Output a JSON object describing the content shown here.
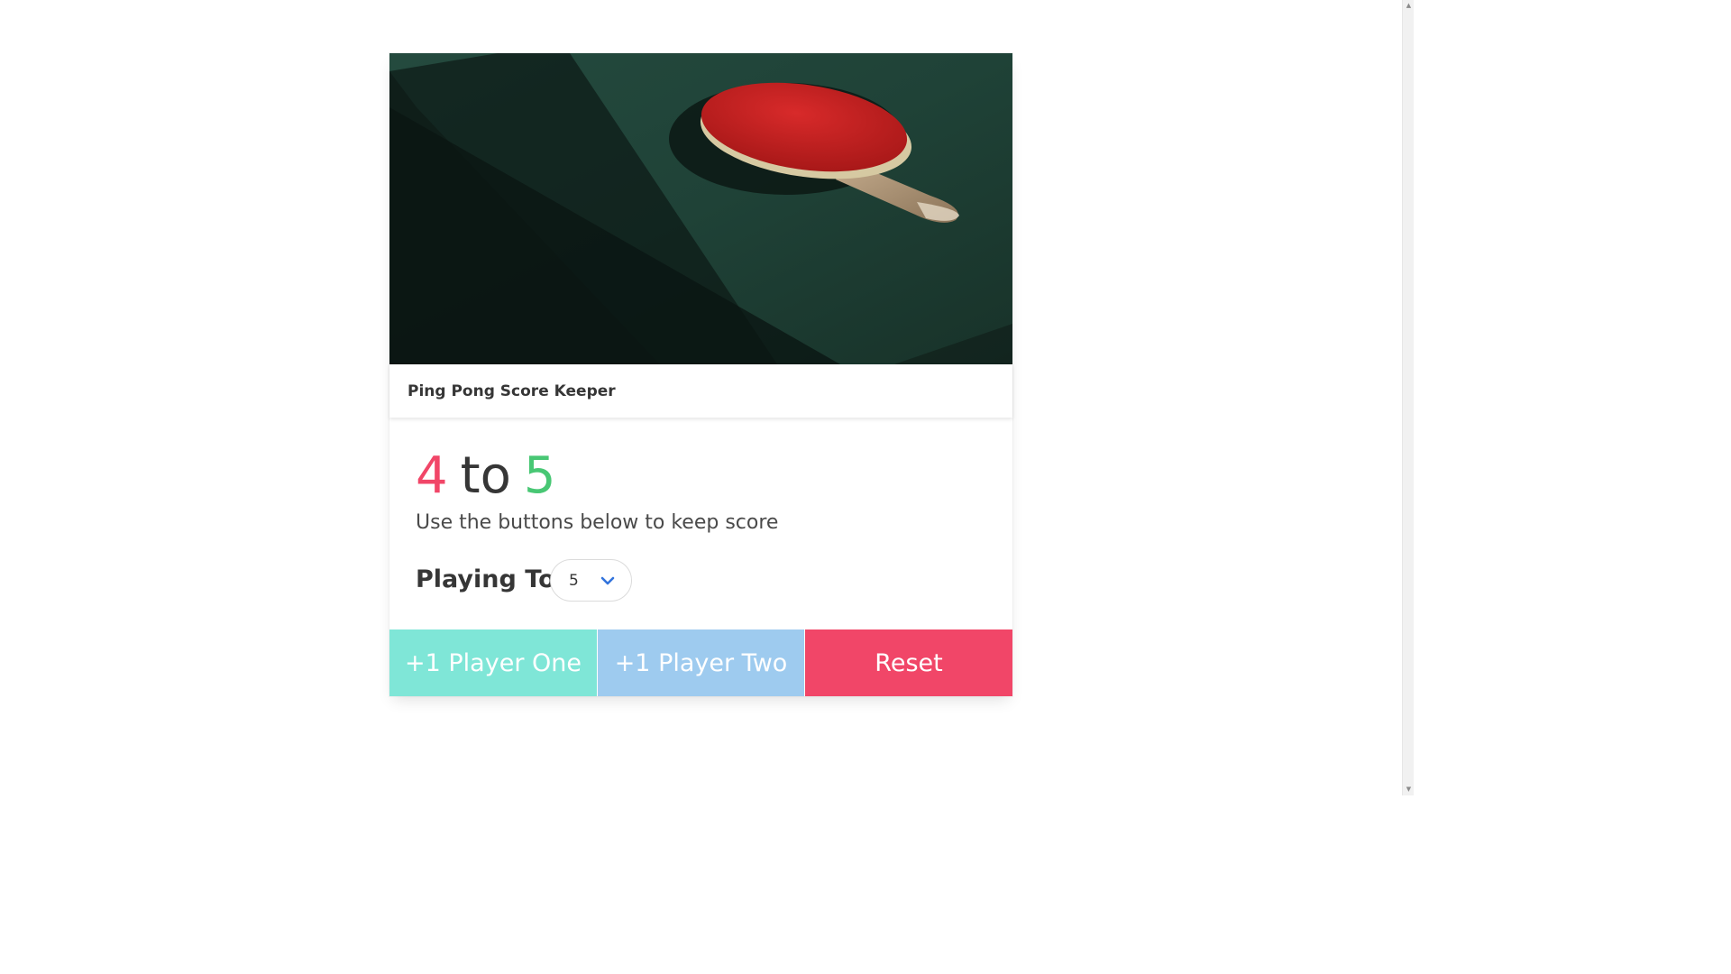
{
  "card": {
    "header_title": "Ping Pong Score Keeper",
    "image_alt": "ping pong paddle on table"
  },
  "score": {
    "player_one": "4",
    "separator": "to",
    "player_two": "5",
    "player_one_color": "#f14668",
    "player_two_color": "#48c774"
  },
  "subtitle": "Use the buttons below to keep score",
  "playing_to": {
    "label": "Playing To",
    "selected": "5"
  },
  "buttons": {
    "player_one": "+1 Player One",
    "player_two": "+1 Player Two",
    "reset": "Reset",
    "player_one_color": "#7fe6d7",
    "player_two_color": "#9ecbef",
    "reset_color": "#f14668"
  }
}
